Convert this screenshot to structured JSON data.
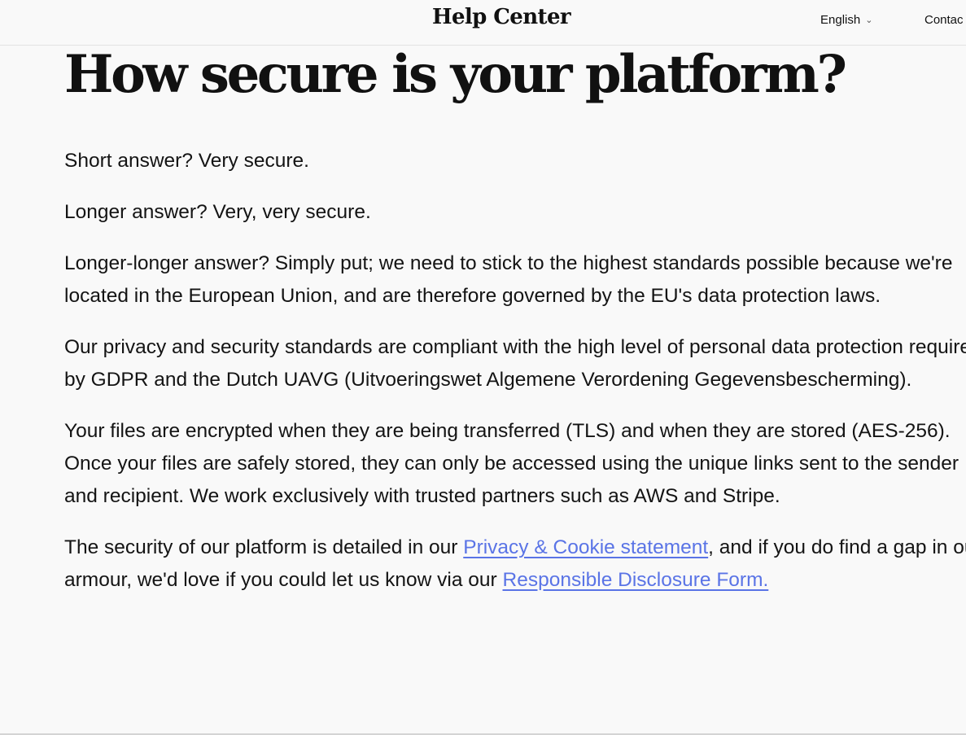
{
  "header": {
    "brand": "Help Center",
    "language": "English",
    "contact": "Contac"
  },
  "article": {
    "title": "How secure is your platform?",
    "p1": "Short answer? Very secure.",
    "p2": "Longer answer? Very, very secure.",
    "p3": "Longer-longer answer? Simply put; we need to stick to the highest standards possible because we're located in the European Union, and are therefore governed by the EU's data protection laws.",
    "p4": "Our privacy and security standards are compliant with the high level of personal data protection required by GDPR and the Dutch UAVG (Uitvoeringswet Algemene Verordening Gegevensbescherming).",
    "p5": "Your files are encrypted when they are being transferred (TLS) and when they are stored (AES-256). Once your files are safely stored, they can only be accessed using the unique links sent to the sender and recipient. We work exclusively with trusted partners such as AWS and Stripe.",
    "p6_before": "The security of our platform is detailed in our ",
    "p6_link1": "Privacy & Cookie statement",
    "p6_middle": ", and if you do find a gap in our armour, we'd love if you could let us know via our ",
    "p6_link2": "Responsible Disclosure Form."
  },
  "colors": {
    "background": "#f9f9f9",
    "text": "#121212",
    "link": "#5a74e6"
  },
  "icons": {
    "language_dropdown": "chevron-down-icon"
  }
}
